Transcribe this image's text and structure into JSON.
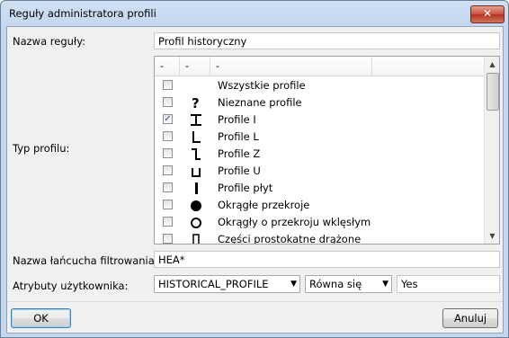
{
  "window": {
    "title": "Reguły administratora profili",
    "close_label": "✕"
  },
  "rule_name": {
    "label": "Nazwa reguły:",
    "value": "Profil historyczny"
  },
  "profile_type": {
    "label": "Typ profilu:",
    "columns": [
      "-",
      "-",
      "-"
    ],
    "items": [
      {
        "label": "Wszystkie profile",
        "checked": false,
        "icon": "none"
      },
      {
        "label": "Nieznane profile",
        "checked": false,
        "icon": "question-icon"
      },
      {
        "label": "Profile I",
        "checked": true,
        "icon": "i-beam-icon"
      },
      {
        "label": "Profile L",
        "checked": false,
        "icon": "l-profile-icon"
      },
      {
        "label": "Profile Z",
        "checked": false,
        "icon": "z-profile-icon"
      },
      {
        "label": "Profile U",
        "checked": false,
        "icon": "u-profile-icon"
      },
      {
        "label": "Profile płyt",
        "checked": false,
        "icon": "plate-profile-icon"
      },
      {
        "label": "Okrągłe przekroje",
        "checked": false,
        "icon": "round-bar-icon"
      },
      {
        "label": "Okrągły o przekroju wklęsłym",
        "checked": false,
        "icon": "circular-hollow-icon"
      },
      {
        "label": "Części prostokatne drążone",
        "checked": false,
        "icon": "rectangular-hollow-icon"
      }
    ]
  },
  "filter_chain": {
    "label": "Nazwa łańcucha filtrowania:",
    "value": "HEA*"
  },
  "user_attributes": {
    "label": "Atrybuty użytkownika:",
    "attribute": "HISTORICAL_PROFILE",
    "operator": "Równa się",
    "value": "Yes"
  },
  "buttons": {
    "ok": "OK",
    "cancel": "Anuluj"
  }
}
